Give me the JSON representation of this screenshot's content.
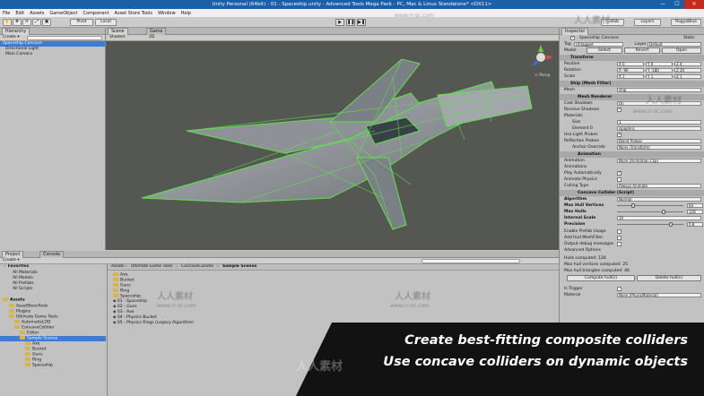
{
  "window": {
    "title": "Unity Personal (64bit) - 01 - Spaceship.unity - Advanced Tools Mega Pack - PC, Mac & Linux Standalone* <DX11>",
    "min": "—",
    "max": "☐",
    "close": "✕"
  },
  "menu": [
    "File",
    "Edit",
    "Assets",
    "GameObject",
    "Component",
    "Asset Store Tools",
    "Window",
    "Help"
  ],
  "toolbar": {
    "pivot": "Pivot",
    "local": "Local",
    "play_icon": "▶",
    "pause_icon": "❚❚",
    "step_icon": "▶❚",
    "collab": "Collab",
    "account": "Account",
    "layers": "Layers",
    "layout": "RogyaBlue"
  },
  "hierarchy": {
    "tab": "Hierarchy",
    "create": "Create ▾",
    "items": [
      "Spaceship Concave",
      "Directional Light",
      "Main Camera"
    ]
  },
  "scene": {
    "tab_scene": "Scene",
    "tab_game": "Game",
    "shading": "Shaded",
    "mode": "2D",
    "persp": "< Persp"
  },
  "inspector": {
    "tab": "Inspector",
    "object_name": "Spaceship Concave",
    "static": "Static",
    "tag_label": "Tag",
    "tag_value": "Untagged",
    "layer_label": "Layer",
    "layer_value": "Default",
    "prefab_buttons": [
      "Model",
      "Select",
      "Revert",
      "Open"
    ],
    "transform": {
      "header": "Transform",
      "position": "Position",
      "rotation": "Rotation",
      "scale": "Scale",
      "pos": [
        "X 0",
        "Y 0",
        "Z 4"
      ],
      "rot": [
        "X -90",
        "Y -180",
        "Z 20"
      ],
      "scl": [
        "X 1",
        "Y 1",
        "Z 1"
      ]
    },
    "mesh_filter": {
      "header": "Ship (Mesh Filter)",
      "mesh_label": "Mesh",
      "mesh_value": "ship"
    },
    "mesh_renderer": {
      "header": "Mesh Renderer",
      "cast_shadows": "Cast Shadows",
      "cast_value": "On",
      "receive_shadows": "Receive Shadows",
      "materials": "Materials",
      "size": "Size",
      "size_value": "1",
      "element0": "Element 0",
      "element0_value": "sipophnc",
      "light_probes": "Use Light Probes",
      "reflection_probes": "Reflection Probes",
      "reflection_value": "Blend Probes",
      "anchor": "Anchor Override",
      "anchor_value": "None (Transform)"
    },
    "animation": {
      "header": "Animation",
      "animation": "Animation",
      "animation_value": "None (Animation Clip)",
      "animations": "Animations",
      "play_auto": "Play Automatically",
      "animate_physics": "Animate Physics",
      "culling": "Culling Type",
      "culling_value": "Always Animate"
    },
    "concave": {
      "header": "Concave Collider (Script)",
      "algorithm": "Algorithm",
      "algorithm_value": "Normal",
      "max_hull_vertices": "Max Hull Vertices",
      "mhv_value": "64",
      "max_hulls": "Max Hulls",
      "mh_value": "128",
      "internal_scale": "Internal Scale",
      "is_value": "10",
      "precision": "Precision",
      "pr_value": "0.8",
      "enable_prefab": "Enable Prefab Usage",
      "add_hull": "Add Hull MeshFilter",
      "output_debug": "Output debug messages",
      "advanced": "Advanced Options",
      "hulls_computed": "Hulls computed: 128",
      "max_vertices_computed": "Max hull vertices computed: 25",
      "max_triangles_computed": "Max hull triangles computed: 46",
      "compute_btn": "Compute hull(s)",
      "delete_btn": "Delete hull(s)"
    },
    "is_trigger": "Is Trigger",
    "material": "Material",
    "material_value": "None (PhysicMaterial)"
  },
  "project": {
    "tab_project": "Project",
    "tab_console": "Console",
    "create": "Create ▾",
    "tree": [
      "Favorites",
      "All Materials",
      "All Models",
      "All Prefabs",
      "All Scripts",
      "Assets",
      "AssetStoreTools",
      "Plugins",
      "Ultimate Game Tools",
      "AutomaticLOD",
      "ConcaveCollider",
      "Editor",
      "Sample Scenes",
      "Axe",
      "Bucket",
      "Guns",
      "Ring",
      "Spaceship"
    ],
    "breadcrumb": [
      "Assets",
      "Ultimate Game Tools",
      "ConcaveCollider",
      "Sample Scenes"
    ],
    "files": [
      "Axe",
      "Bucket",
      "Guns",
      "Ring",
      "Spaceship",
      "01 - Spaceship",
      "02 - Guns",
      "03 - Axe",
      "04 - Physics Bucket",
      "05 - Physics Rings (Legacy Algorithm)"
    ]
  },
  "caption": {
    "line1": "Create best-fitting composite colliders",
    "line2": "Use concave colliders on dynamic objects"
  },
  "watermark": {
    "url": "www.rr-sc.com",
    "cn": "人人素材"
  },
  "colors": {
    "selection": "#3d7bd6",
    "wireframe": "#5fe34a",
    "titlebar": "#1b5fa8",
    "scene_bg": "#555753"
  }
}
